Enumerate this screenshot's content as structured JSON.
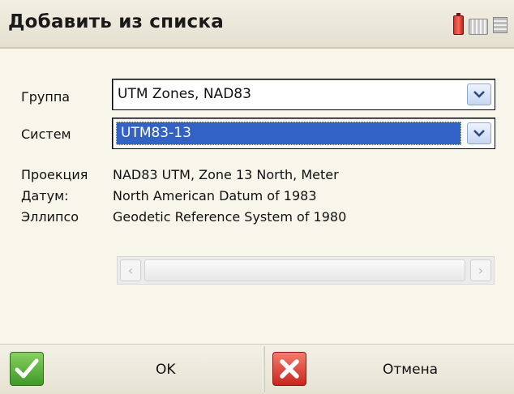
{
  "window": {
    "title": "Добавить из списка",
    "tray_icons": [
      "battery-icon",
      "keyboard-icon",
      "input-panel-icon"
    ],
    "colors": {
      "selection": "#3162c4",
      "battery": "#d8322f",
      "ok": "#3f9a27",
      "cancel": "#c9251d"
    }
  },
  "form": {
    "group_label": "Группа",
    "group_value": "UTM Zones, NAD83",
    "system_label": "Систем",
    "system_value": "UTM83-13"
  },
  "info": {
    "projection_label": "Проекция",
    "projection_value": "NAD83 UTM, Zone 13 North, Meter",
    "datum_label": "Датум:",
    "datum_value": "North American Datum of 1983",
    "ellipsoid_label": "Эллипсо",
    "ellipsoid_value": "Geodetic Reference System of 1980"
  },
  "scrollbar": {
    "left_glyph": "‹",
    "right_glyph": "›"
  },
  "buttons": {
    "ok_label": "OK",
    "cancel_label": "Отмена"
  }
}
